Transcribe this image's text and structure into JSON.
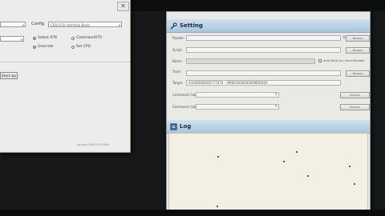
{
  "left_window": {
    "config_label": "Config",
    "config_value": "CE8 SCSI Interface Basic",
    "radio_options": [
      {
        "label": "Select X76",
        "checked": true
      },
      {
        "label": "CommandX75",
        "checked": false
      },
      {
        "label": "Override",
        "checked": true
      },
      {
        "label": "Set CPU",
        "checked": false
      }
    ],
    "button_label": "Start bp",
    "status_text": "Version 2985 2019 Mar"
  },
  "setting_window": {
    "title": "Setting",
    "fields": [
      {
        "label": "Reader",
        "value": ""
      },
      {
        "label": "Script",
        "value": ""
      },
      {
        "label": "Name",
        "value": ""
      },
      {
        "label": "Track",
        "value": ""
      },
      {
        "label": "Target",
        "value": "A1000000000777074 - 3MN1000000000MD0200"
      },
      {
        "label": "Command Cable",
        "value": ""
      },
      {
        "label": "Command Cable",
        "value": ""
      }
    ],
    "checkbox_label": "Auto Mode Arc Serial Number",
    "browse_label": "Browse",
    "log_title": "Log"
  },
  "colors": {
    "header_top": "#cfe1ef",
    "header_bottom": "#a9c6dd",
    "log_background": "#f3efe2",
    "window_background": "#e9e9e5"
  }
}
